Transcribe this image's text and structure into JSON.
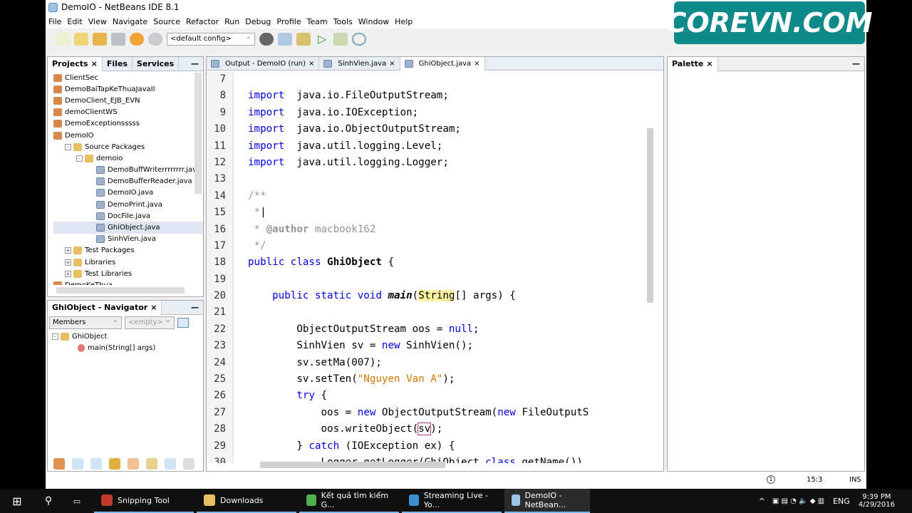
{
  "window": {
    "title": "DemoIO - NetBeans IDE 8.1"
  },
  "menu": [
    "File",
    "Edit",
    "View",
    "Navigate",
    "Source",
    "Refactor",
    "Run",
    "Debug",
    "Profile",
    "Team",
    "Tools",
    "Window",
    "Help"
  ],
  "toolbar": {
    "config": "<default config>"
  },
  "projects": {
    "tabs": [
      "Projects",
      "Files",
      "Services"
    ],
    "items": [
      {
        "label": "ClientSec",
        "indent": 0,
        "icon": "project-icon"
      },
      {
        "label": "DemoBaiTapKeThuaJavaII",
        "indent": 0,
        "icon": "project-icon"
      },
      {
        "label": "DemoClient_EJB_EVN",
        "indent": 0,
        "icon": "project-icon"
      },
      {
        "label": "demoClientWS",
        "indent": 0,
        "icon": "project-icon"
      },
      {
        "label": "DemoExceptionsssss",
        "indent": 0,
        "icon": "project-icon"
      },
      {
        "label": "DemoIO",
        "indent": 0,
        "icon": "project-icon"
      },
      {
        "label": "Source Packages",
        "indent": 1,
        "icon": "folder-icon",
        "exp": "-"
      },
      {
        "label": "demoio",
        "indent": 2,
        "icon": "package-icon",
        "exp": "-"
      },
      {
        "label": "DemoBuffWriterrrrrrrr.java",
        "indent": 3,
        "icon": "java-file-icon"
      },
      {
        "label": "DemoBufferReader.java",
        "indent": 3,
        "icon": "java-file-icon"
      },
      {
        "label": "DemoIO.java",
        "indent": 3,
        "icon": "java-file-icon"
      },
      {
        "label": "DemoPrint.java",
        "indent": 3,
        "icon": "java-file-icon"
      },
      {
        "label": "DocFile.java",
        "indent": 3,
        "icon": "java-file-icon"
      },
      {
        "label": "GhiObject.java",
        "indent": 3,
        "icon": "java-file-icon",
        "selected": true
      },
      {
        "label": "SinhVien.java",
        "indent": 3,
        "icon": "java-file-icon"
      },
      {
        "label": "Test Packages",
        "indent": 1,
        "icon": "folder-icon",
        "exp": "+"
      },
      {
        "label": "Libraries",
        "indent": 1,
        "icon": "folder-icon",
        "exp": "+"
      },
      {
        "label": "Test Libraries",
        "indent": 1,
        "icon": "folder-icon",
        "exp": "+"
      },
      {
        "label": "DemoKeThua",
        "indent": 0,
        "icon": "project-icon"
      }
    ]
  },
  "navigator": {
    "title": "GhiObject - Navigator",
    "filter": "Members",
    "empty": "<empty>",
    "class": "GhiObject",
    "method": "main(String[] args)"
  },
  "editor": {
    "tabs": [
      "Output - DemoIO (run)",
      "SinhVien.java",
      "GhiObject.java"
    ],
    "active_tab": 2,
    "lines": [
      {
        "n": "7",
        "t": []
      },
      {
        "n": "8",
        "t": [
          [
            "kw",
            "import"
          ],
          [
            "",
            "  java.io.FileOutputStream;"
          ]
        ]
      },
      {
        "n": "9",
        "t": [
          [
            "kw",
            "import"
          ],
          [
            "",
            "  java.io.IOException;"
          ]
        ]
      },
      {
        "n": "10",
        "t": [
          [
            "kw",
            "import"
          ],
          [
            "",
            "  java.io.ObjectOutputStream;"
          ]
        ]
      },
      {
        "n": "11",
        "t": [
          [
            "kw",
            "import"
          ],
          [
            "",
            "  java.util.logging.Level;"
          ]
        ]
      },
      {
        "n": "12",
        "t": [
          [
            "kw",
            "import"
          ],
          [
            "",
            "  java.util.logging.Logger;"
          ]
        ]
      },
      {
        "n": "13",
        "t": []
      },
      {
        "n": "14",
        "t": [
          [
            "cmt",
            "/**"
          ]
        ]
      },
      {
        "n": "15",
        "t": [
          [
            "cmt",
            " *"
          ],
          [
            "",
            "|"
          ]
        ]
      },
      {
        "n": "16",
        "t": [
          [
            "cmt",
            " * "
          ],
          [
            "ann",
            "@author"
          ],
          [
            "cmt",
            " macbook162"
          ]
        ]
      },
      {
        "n": "17",
        "t": [
          [
            "cmt",
            " */"
          ]
        ]
      },
      {
        "n": "18",
        "t": [
          [
            "kw",
            "public class "
          ],
          [
            "bold",
            "GhiObject"
          ],
          [
            "",
            " {"
          ]
        ]
      },
      {
        "n": "19",
        "t": []
      },
      {
        "n": "20",
        "t": [
          [
            "",
            "    "
          ],
          [
            "kw",
            "public static void "
          ],
          [
            "mth",
            "main"
          ],
          [
            "",
            "("
          ],
          [
            "hl",
            "String"
          ],
          [
            "",
            "[] args) {"
          ]
        ]
      },
      {
        "n": "21",
        "t": []
      },
      {
        "n": "22",
        "t": [
          [
            "",
            "        ObjectOutputStream oos = "
          ],
          [
            "kw",
            "null"
          ],
          [
            "",
            ";"
          ]
        ]
      },
      {
        "n": "23",
        "t": [
          [
            "",
            "        SinhVien sv = "
          ],
          [
            "kw",
            "new"
          ],
          [
            "",
            " SinhVien();"
          ]
        ]
      },
      {
        "n": "24",
        "t": [
          [
            "",
            "        sv.setMa(007);"
          ]
        ]
      },
      {
        "n": "25",
        "t": [
          [
            "",
            "        sv.setTen("
          ],
          [
            "str",
            "\"Nguyen Van A\""
          ],
          [
            "",
            ");"
          ]
        ]
      },
      {
        "n": "26",
        "t": [
          [
            "",
            "        "
          ],
          [
            "kw",
            "try"
          ],
          [
            "",
            " {"
          ]
        ]
      },
      {
        "n": "27",
        "t": [
          [
            "",
            "            oos = "
          ],
          [
            "kw",
            "new"
          ],
          [
            "",
            " ObjectOutputStream("
          ],
          [
            "kw",
            "new"
          ],
          [
            "",
            " FileOutputS"
          ]
        ]
      },
      {
        "n": "28",
        "t": [
          [
            "",
            "            oos.writeObject("
          ],
          [
            "box",
            "sv"
          ],
          [
            "",
            ");"
          ]
        ]
      },
      {
        "n": "29",
        "t": [
          [
            "",
            "        } "
          ],
          [
            "kw",
            "catch"
          ],
          [
            "",
            " (IOException ex) {"
          ]
        ]
      },
      {
        "n": "30",
        "t": [
          [
            "",
            "            Logger.getLogger(GhiObject."
          ],
          [
            "kw",
            "class"
          ],
          [
            "",
            ".getName())."
          ]
        ]
      }
    ]
  },
  "palette": {
    "title": "Palette"
  },
  "status": {
    "notifications": "1",
    "position": "15:3",
    "mode": "INS"
  },
  "taskbar": {
    "items": [
      "Snipping Tool",
      "Downloads",
      "Kết quả tìm kiếm G...",
      "Streaming Live - Yo...",
      "DemoIO - NetBean..."
    ],
    "lang": "ENG",
    "time": "9:39 PM",
    "date": "4/29/2016"
  },
  "watermark": "COREVN.COM"
}
